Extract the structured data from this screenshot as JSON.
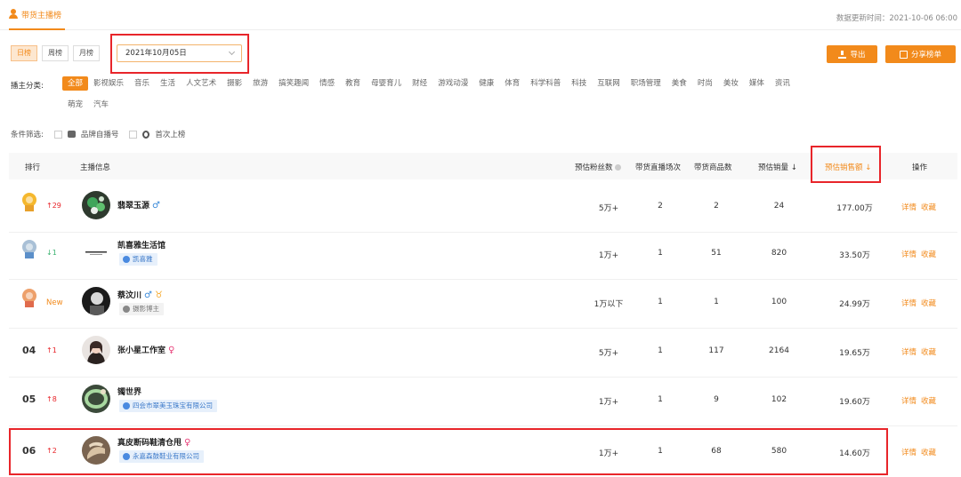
{
  "header": {
    "tab_label": "带货主播榜",
    "update_time": "数据更新时间：2021-10-06 06:00"
  },
  "period": {
    "tabs": [
      "日榜",
      "周榜",
      "月榜"
    ],
    "active_index": 0,
    "date_value": "2021年10月05日"
  },
  "actions": {
    "export_label": "导出",
    "share_label": "分享榜单"
  },
  "category": {
    "label": "播主分类:",
    "items": [
      "全部",
      "影视娱乐",
      "音乐",
      "生活",
      "人文艺术",
      "摄影",
      "旅游",
      "搞笑趣闻",
      "情感",
      "教育",
      "母婴育儿",
      "财经",
      "游戏动漫",
      "健康",
      "体育",
      "科学科普",
      "科技",
      "互联网",
      "职场管理",
      "美食",
      "时尚",
      "美妆",
      "媒体",
      "资讯"
    ],
    "items_row2": [
      "萌宠",
      "汽车"
    ],
    "active": "全部"
  },
  "conditions": {
    "label": "条件筛选:",
    "brand_label": "品牌自播号",
    "first_label": "首次上榜"
  },
  "table": {
    "headers": {
      "rank": "排行",
      "info": "主播信息",
      "fans": "预估粉丝数",
      "live": "带货直播场次",
      "goods": "带货商品数",
      "volume": "预估销量",
      "sales": "预估销售额",
      "ops": "操作"
    },
    "ops": {
      "detail": "详情",
      "collect": "收藏"
    },
    "rows": [
      {
        "rank": "1",
        "change": "29",
        "name": "翡翠玉源",
        "tag": "",
        "fans": "5万+",
        "live": "2",
        "goods": "2",
        "volume": "24",
        "sales": "177.00万"
      },
      {
        "rank": "2",
        "change": "1",
        "name": "凯喜雅生活馆",
        "tag": "凯喜雅",
        "fans": "1万+",
        "live": "1",
        "goods": "51",
        "volume": "820",
        "sales": "33.50万"
      },
      {
        "rank": "3",
        "change": "New",
        "name": "蔡汶川",
        "tag": "摄影博主",
        "fans": "1万以下",
        "live": "1",
        "goods": "1",
        "volume": "100",
        "sales": "24.99万"
      },
      {
        "rank": "04",
        "change": "1",
        "name": "张小星工作室",
        "tag": "",
        "fans": "5万+",
        "live": "1",
        "goods": "117",
        "volume": "2164",
        "sales": "19.65万"
      },
      {
        "rank": "05",
        "change": "8",
        "name": "镯世界",
        "tag": "四会市翠美玉珠宝有限公司",
        "fans": "1万+",
        "live": "1",
        "goods": "9",
        "volume": "102",
        "sales": "19.60万"
      },
      {
        "rank": "06",
        "change": "2",
        "name": "真皮断码鞋清仓甩",
        "tag": "永嘉森鼓鞋业有限公司",
        "fans": "1万+",
        "live": "1",
        "goods": "68",
        "volume": "580",
        "sales": "14.60万"
      }
    ]
  },
  "colors": {
    "accent": "#f28a1b",
    "highlight_box": "#e8252a",
    "up": "#e8252a",
    "down": "#3cb371"
  }
}
